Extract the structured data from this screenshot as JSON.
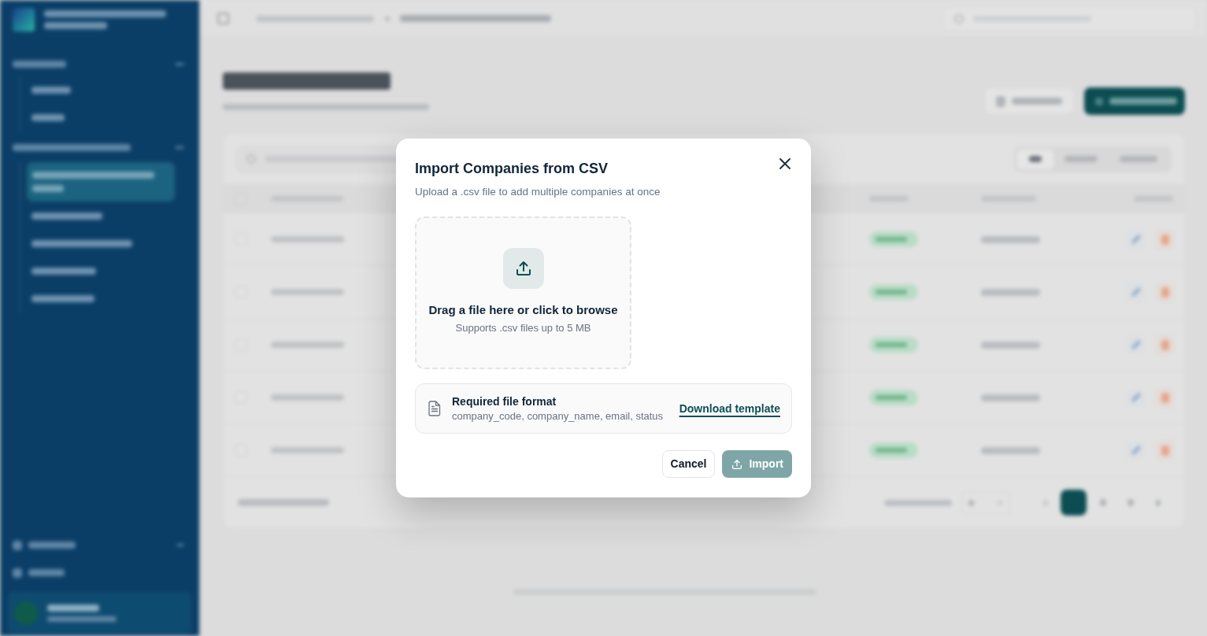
{
  "dialog": {
    "title": "Import Companies from CSV",
    "subtitle": "Upload a .csv file to add multiple companies at once",
    "dropzone": {
      "prompt": "Drag a file here or click to browse",
      "hint": "Supports .csv files up to 5 MB"
    },
    "format_note": {
      "title": "Required file format",
      "columns": "company_code, company_name, email, status",
      "link": "Download template"
    },
    "buttons": [
      {
        "label": "Cancel",
        "kind": "secondary",
        "disabled": false
      },
      {
        "label": "Import",
        "kind": "primary",
        "disabled": true
      }
    ]
  }
}
